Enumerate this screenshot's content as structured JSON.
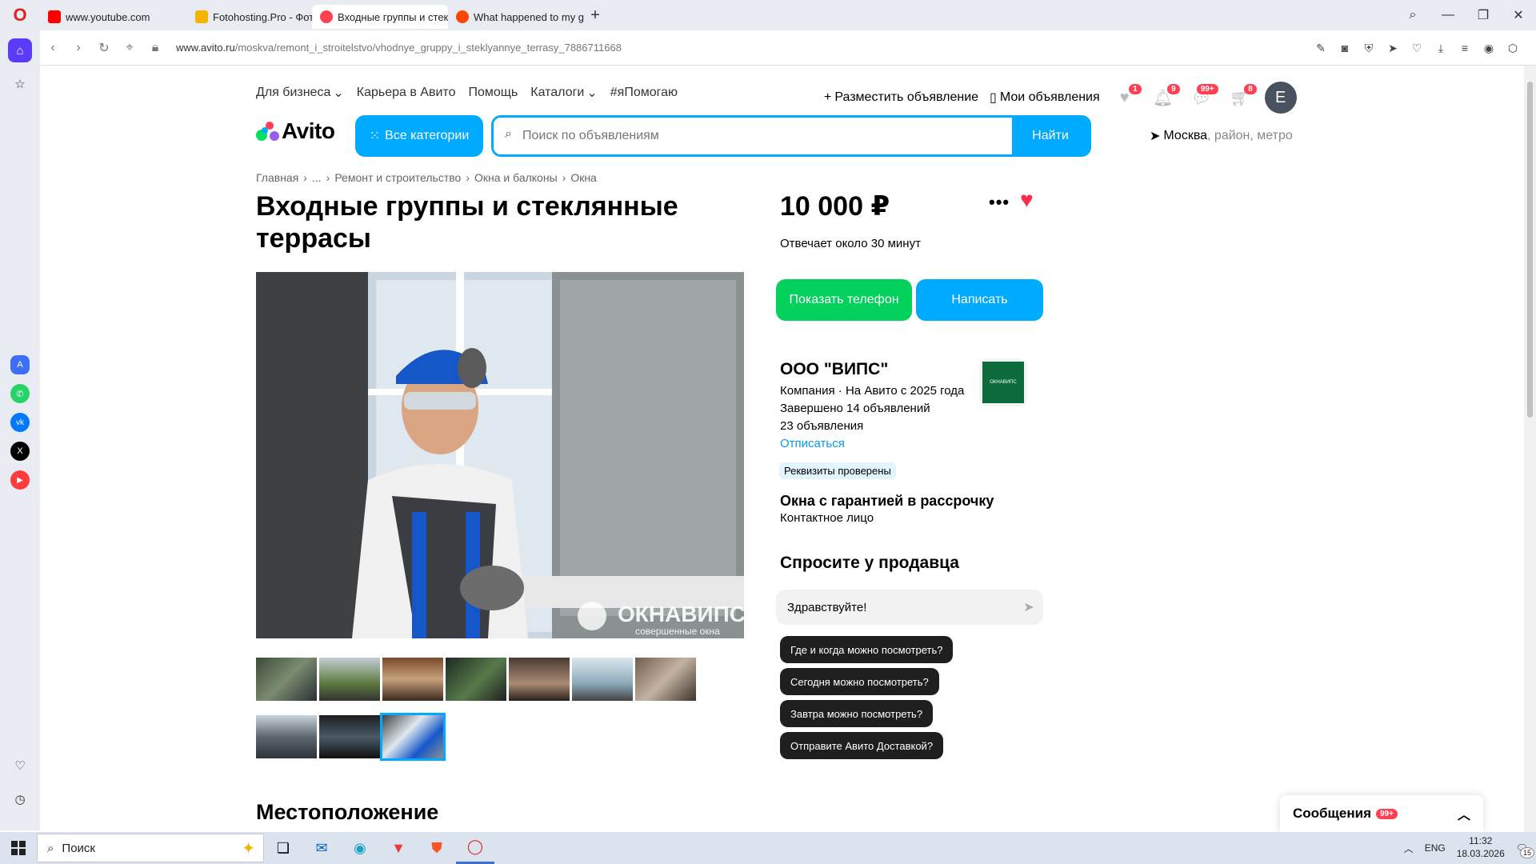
{
  "browser": {
    "tabs": [
      {
        "label": "www.youtube.com",
        "color": "#ff0000"
      },
      {
        "label": "Fotohosting.Pro - Фотохо",
        "color": "#f4b400"
      },
      {
        "label": "Входные группы и стекл",
        "color": "#ff4053"
      },
      {
        "label": "What happened to my go",
        "color": "#ff4500"
      }
    ],
    "url_host": "www.avito.ru",
    "url_path": "/moskva/remont_i_stroitelstvo/vhodnye_gruppy_i_steklyannye_terrasy_7886711668"
  },
  "topnav": {
    "items": [
      "Для бизнеса",
      "Карьера в Авито",
      "Помощь",
      "Каталоги",
      "#яПомогаю"
    ],
    "post_ad": "Разместить объявление",
    "my_ads": "Мои объявления",
    "badges": {
      "favorites": "1",
      "notifications": "9",
      "messages": "99+",
      "cart": "8"
    },
    "avatar_letter": "E"
  },
  "header": {
    "logo": "Avito",
    "categories_button": "Все категории",
    "search_placeholder": "Поиск по объявлениям",
    "search_button": "Найти",
    "location_city": "Москва",
    "location_hint": ", район, метро"
  },
  "breadcrumb": [
    "Главная",
    "...",
    "Ремонт и строительство",
    "Окна и балконы",
    "Окна"
  ],
  "listing": {
    "title": "Входные группы и стеклянные террасы",
    "watermark_brand": "ОКНАВИПС",
    "watermark_tag": "совершенные окна",
    "price": "10 000 ₽",
    "reply_time": "Отвечает около 30 минут",
    "show_phone": "Показать телефон",
    "write": "Написать"
  },
  "seller": {
    "name": "ООО \"ВИПС\"",
    "type_line": "Компания · На Авито с 2025 года",
    "completed": "Завершено 14 объявлений",
    "active": "23 объявления",
    "unsubscribe": "Отписаться",
    "logo_text": "ОКНАВИПС",
    "verified": "Реквизиты проверены",
    "company_title": "Окна с гарантией в рассрочку",
    "contact_person": "Контактное лицо"
  },
  "ask": {
    "heading": "Спросите у продавца",
    "input_value": "Здравствуйте!",
    "quick_questions": [
      "Где и когда можно посмотреть?",
      "Сегодня можно посмотреть?",
      "Завтра можно посмотреть?",
      "Отправите Авито Доставкой?"
    ]
  },
  "location_heading": "Местоположение",
  "messages_panel": {
    "label": "Сообщения",
    "badge": "99+"
  },
  "taskbar": {
    "search": "Поиск",
    "lang": "ENG",
    "time": "11:32",
    "date": "18.03.2026",
    "notif": "15"
  },
  "colors": {
    "accent": "#00aaff",
    "green": "#02d15c",
    "red": "#ff4053"
  }
}
